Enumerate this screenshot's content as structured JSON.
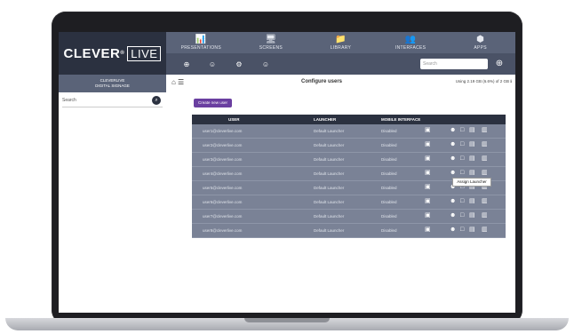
{
  "brand": {
    "name": "CLEVER",
    "mark": "®",
    "box_text": "LIVE"
  },
  "nav": [
    {
      "label": "PRESENTATIONS",
      "icon": "📊"
    },
    {
      "label": "SCREENS",
      "icon": "🖥"
    },
    {
      "label": "LIBRARY",
      "icon": "📁"
    },
    {
      "label": "INTERFACES",
      "icon": "👥"
    },
    {
      "label": "APPS",
      "icon": "⬢"
    }
  ],
  "toolbar": {
    "icons": [
      "⊕",
      "☺",
      "⚙",
      "☺"
    ],
    "search_placeholder": "Search",
    "search_go": "⊕"
  },
  "sidebar": {
    "org": "CLEVERLIVE",
    "org_sub": "DIGITAL SIGNAGE",
    "search_placeholder": "Search",
    "search_icon": "⌕"
  },
  "main": {
    "breadcrumb": "⌂ ☰",
    "title": "Configure users",
    "usage": "Using 2.19 GB (6.6%) of 2 GB ℹ",
    "create_label": "Create new user",
    "table": {
      "headers": [
        "USER",
        "LAUNCHER",
        "MOBILE INTERFACE"
      ],
      "rows": [
        {
          "user": "user1@cleverlive.com",
          "launcher": "Default Launcher",
          "mobile": "Disabled"
        },
        {
          "user": "user2@cleverlive.com",
          "launcher": "Default Launcher",
          "mobile": "Disabled"
        },
        {
          "user": "user3@cleverlive.com",
          "launcher": "Default Launcher",
          "mobile": "Disabled"
        },
        {
          "user": "user4@cleverlive.com",
          "launcher": "Default Launcher",
          "mobile": "Disabled"
        },
        {
          "user": "user5@cleverlive.com",
          "launcher": "Default Launcher",
          "mobile": "Disabled"
        },
        {
          "user": "user6@cleverlive.com",
          "launcher": "Default Launcher",
          "mobile": "Disabled"
        },
        {
          "user": "user7@cleverlive.com",
          "launcher": "Default Launcher",
          "mobile": "Disabled"
        },
        {
          "user": "user8@cleverlive.com",
          "launcher": "Default Launcher",
          "mobile": "Disabled"
        }
      ]
    },
    "tooltip": "Assign Launcher"
  }
}
